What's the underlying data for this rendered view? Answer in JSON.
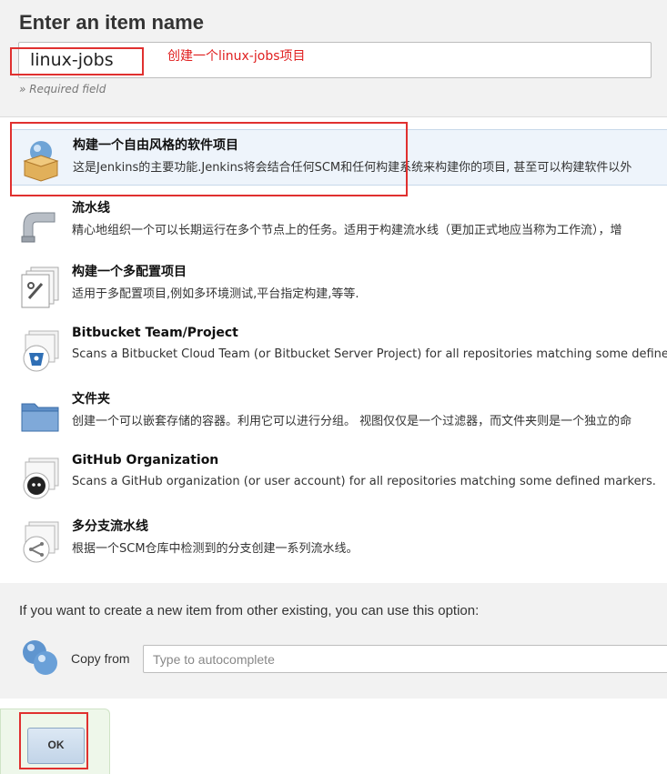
{
  "header": {
    "title": "Enter an item name",
    "name_value": "linux-jobs",
    "required_note": "» Required field"
  },
  "annotation": {
    "text": "创建一个linux-jobs项目",
    "color": "#e0302f"
  },
  "item_types": [
    {
      "name": "构建一个自由风格的软件项目",
      "description": "这是Jenkins的主要功能.Jenkins将会结合任何SCM和任何构建系统来构建你的项目, 甚至可以构建软件以外",
      "icon": "freestyle-box-icon",
      "selected": true
    },
    {
      "name": "流水线",
      "description": "精心地组织一个可以长期运行在多个节点上的任务。适用于构建流水线（更加正式地应当称为工作流），增",
      "icon": "pipeline-icon"
    },
    {
      "name": "构建一个多配置项目",
      "description": "适用于多配置项目,例如多环境测试,平台指定构建,等等.",
      "icon": "multi-config-icon"
    },
    {
      "name": "Bitbucket Team/Project",
      "description": "Scans a Bitbucket Cloud Team (or Bitbucket Server Project) for all repositories matching some defined ma",
      "icon": "bitbucket-icon"
    },
    {
      "name": "文件夹",
      "description": "创建一个可以嵌套存储的容器。利用它可以进行分组。 视图仅仅是一个过滤器，而文件夹则是一个独立的命",
      "icon": "folder-icon"
    },
    {
      "name": "GitHub Organization",
      "description": "Scans a GitHub organization (or user account) for all repositories matching some defined markers.",
      "icon": "github-icon"
    },
    {
      "name": "多分支流水线",
      "description": "根据一个SCM仓库中检测到的分支创建一系列流水线。",
      "icon": "multibranch-icon"
    }
  ],
  "copy": {
    "hint": "If you want to create a new item from other existing, you can use this option:",
    "label": "Copy from",
    "placeholder": "Type to autocomplete"
  },
  "footer": {
    "ok_label": "OK"
  },
  "colors": {
    "accent_red": "#e0302f",
    "selected_bg": "#eef4fb"
  }
}
